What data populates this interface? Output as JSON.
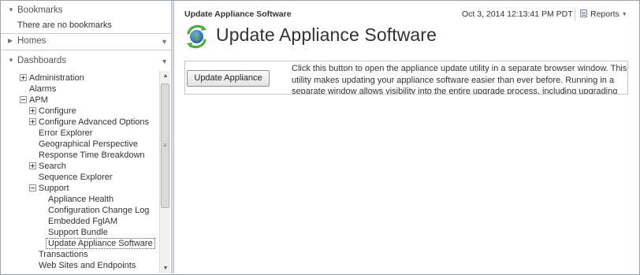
{
  "sidebar": {
    "bookmarks": {
      "label": "Bookmarks",
      "empty_text": "There are no bookmarks"
    },
    "homes": {
      "label": "Homes"
    },
    "dashboards": {
      "label": "Dashboards"
    },
    "tree": [
      {
        "label": "Administration",
        "expander": "plus"
      },
      {
        "label": "Alarms",
        "expander": "none"
      },
      {
        "label": "APM",
        "expander": "minus"
      },
      {
        "label": "Configure",
        "expander": "plus"
      },
      {
        "label": "Configure Advanced Options",
        "expander": "plus"
      },
      {
        "label": "Error Explorer",
        "expander": "none"
      },
      {
        "label": "Geographical Perspective",
        "expander": "none"
      },
      {
        "label": "Response Time Breakdown",
        "expander": "none"
      },
      {
        "label": "Search",
        "expander": "plus"
      },
      {
        "label": "Sequence Explorer",
        "expander": "none"
      },
      {
        "label": "Support",
        "expander": "minus"
      },
      {
        "label": "Appliance Health",
        "expander": "none"
      },
      {
        "label": "Configuration Change Log",
        "expander": "none"
      },
      {
        "label": "Embedded FglAM",
        "expander": "none"
      },
      {
        "label": "Support Bundle",
        "expander": "none"
      },
      {
        "label": "Update Appliance Software",
        "expander": "none",
        "selected": true
      },
      {
        "label": "Transactions",
        "expander": "none"
      },
      {
        "label": "Web Sites and Endpoints",
        "expander": "none"
      }
    ]
  },
  "header": {
    "breadcrumb": "Update Appliance Software",
    "timestamp": "Oct 3, 2014 12:13:41 PM PDT",
    "reports_label": "Reports"
  },
  "main": {
    "title": "Update Appliance Software",
    "button_label": "Update Appliance",
    "description": "Click this button to open the appliance update utility in a separate browser window. This utility makes updating your appliance software easier than ever before. Running in a separate window allows visibility into the entire upgrade process, including upgrading"
  },
  "icons": {
    "title_icon": "globe-refresh-icon",
    "reports_icon": "report-icon"
  }
}
